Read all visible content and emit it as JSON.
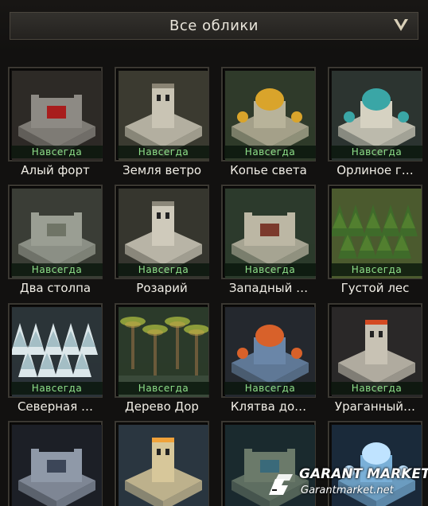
{
  "filter": {
    "label": "Все облики",
    "icon": "chevron-down-icon"
  },
  "skins": [
    {
      "name": "Алый форт",
      "status": "Навсегда",
      "theme": "fort-red"
    },
    {
      "name": "Земля ветро",
      "status": "Навсегда",
      "theme": "tower-white"
    },
    {
      "name": "Копье света",
      "status": "Навсегда",
      "theme": "gold-dome"
    },
    {
      "name": "Орлиное г…",
      "status": "Навсегда",
      "theme": "teal-dome"
    },
    {
      "name": "Два столпа",
      "status": "Навсегда",
      "theme": "stone-castle"
    },
    {
      "name": "Розарий",
      "status": "Навсегда",
      "theme": "white-castle"
    },
    {
      "name": "Западный …",
      "status": "Навсегда",
      "theme": "red-roof"
    },
    {
      "name": "Густой лес",
      "status": "Навсегда",
      "theme": "forest"
    },
    {
      "name": "Северная …",
      "status": "Навсегда",
      "theme": "snow-forest"
    },
    {
      "name": "Дерево Дор",
      "status": "Навсегда",
      "theme": "palms"
    },
    {
      "name": "Клятва до…",
      "status": "Навсегда",
      "theme": "blue-fire"
    },
    {
      "name": "Ураганный…",
      "status": "Навсегда",
      "theme": "fire-tower"
    },
    {
      "name": "",
      "status": "",
      "theme": "dark-fort"
    },
    {
      "name": "",
      "status": "",
      "theme": "glow-tower"
    },
    {
      "name": "",
      "status": "",
      "theme": "ruins"
    },
    {
      "name": "",
      "status": "",
      "theme": "ice-blue"
    }
  ],
  "watermark": {
    "title": "GARANT MARKET",
    "subtitle": "Garantmarket.net"
  }
}
